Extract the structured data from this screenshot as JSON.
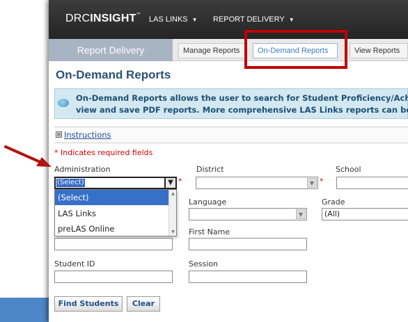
{
  "header": {
    "logo_drc": "DRC",
    "logo_insight": "INSIGHT",
    "logo_tm": "™",
    "nav": [
      {
        "label": "LAS LINKS",
        "caret": "▼"
      },
      {
        "label": "REPORT DELIVERY",
        "caret": "▼"
      }
    ]
  },
  "subnav": {
    "title": "Report Delivery",
    "tabs": [
      {
        "label": "Manage Reports"
      },
      {
        "label": "On-Demand Reports"
      },
      {
        "label": "View Reports"
      }
    ]
  },
  "page": {
    "title": "On-Demand Reports",
    "info_line1": "On-Demand Reports allows the user to search for Student Proficiency/Achievement reports to",
    "info_line2": "view and save PDF reports. More comprehensive LAS Links reports can be found in the reports section.",
    "instructions_toggle": "⊞",
    "instructions_label": "Instructions",
    "required_note": "* Indicates required fields",
    "required_mark": "*"
  },
  "form": {
    "administration": {
      "label": "Administration",
      "value": "(Select)",
      "options": [
        "(Select)",
        "LAS Links",
        "preLAS Online"
      ]
    },
    "district": {
      "label": "District"
    },
    "school": {
      "label": "School"
    },
    "language": {
      "label": "Language"
    },
    "grade": {
      "label": "Grade",
      "value": "(All)"
    },
    "first_name": {
      "label": "First Name"
    },
    "student_id": {
      "label": "Student ID"
    },
    "session": {
      "label": "Session"
    },
    "find_button": "Find Students",
    "clear_button": "Clear"
  },
  "colors": {
    "highlight_box": "#c00000",
    "pointer_arrow": "#b21414",
    "title_color": "#2b4f78",
    "info_bg": "#d4e8f2",
    "selected_option": "#3670c8"
  }
}
